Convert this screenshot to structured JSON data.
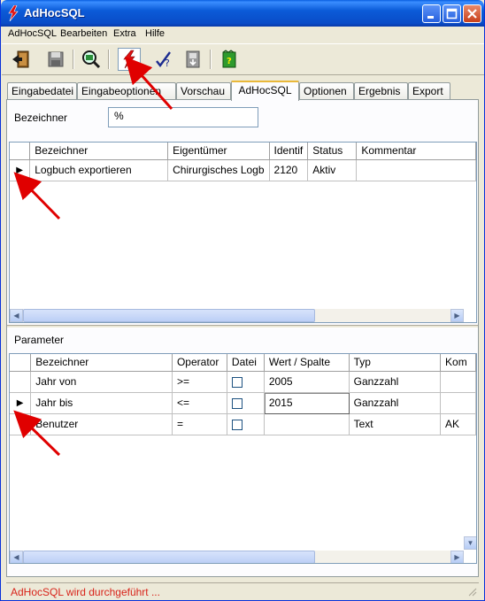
{
  "window": {
    "title": "AdHocSQL"
  },
  "menu": {
    "items": [
      "AdHocSQL",
      "Bearbeiten",
      "Extra",
      "Hilfe"
    ]
  },
  "toolbar": {
    "icons": [
      "exit-door-icon",
      "save-disk-icon",
      "search-database-icon",
      "execute-lightning-icon",
      "check-help-icon",
      "save-clipboard-icon",
      "document-green-icon"
    ]
  },
  "tabs": [
    "Eingabedatei",
    "Eingabeoptionen",
    "Vorschau",
    "AdHocSQL",
    "Optionen",
    "Ergebnis",
    "Export"
  ],
  "active_tab": "AdHocSQL",
  "filter": {
    "label": "Bezeichner",
    "value": "%"
  },
  "query_grid": {
    "columns": [
      "Bezeichner",
      "Eigentümer",
      "Identif",
      "Status",
      "Kommentar"
    ],
    "rows": [
      {
        "indicator": "▶",
        "cells": [
          "Logbuch exportieren",
          "Chirurgisches Logb",
          "2120",
          "Aktiv",
          ""
        ]
      }
    ]
  },
  "parameter": {
    "label": "Parameter",
    "columns": [
      "Bezeichner",
      "Operator",
      "Datei",
      "Wert / Spalte",
      "Typ",
      "Kom"
    ],
    "rows": [
      {
        "indicator": "",
        "cells": [
          "Jahr von",
          ">=",
          "",
          "2005",
          "Ganzzahl",
          ""
        ]
      },
      {
        "indicator": "▶",
        "cells": [
          "Jahr bis",
          "<=",
          "",
          "2015",
          "Ganzzahl",
          ""
        ]
      },
      {
        "indicator": "",
        "cells": [
          "Benutzer",
          "=",
          "",
          "",
          "Text",
          "AK"
        ]
      }
    ]
  },
  "status": {
    "text": "AdHocSQL wird durchgeführt ...",
    "color": "#d8231a"
  },
  "colors": {
    "titlebar": "#0a4cc7",
    "window_bg": "#ece9d8",
    "annotation_arrow": "#e00000"
  }
}
